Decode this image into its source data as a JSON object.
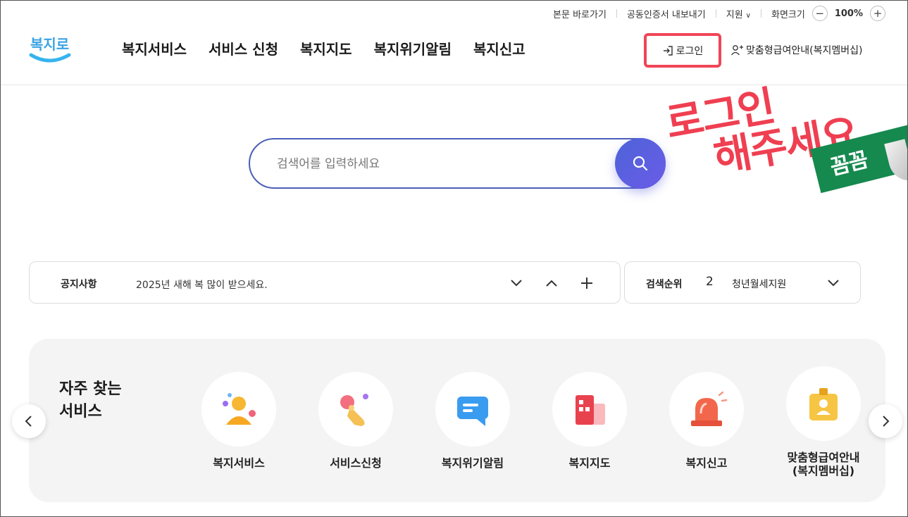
{
  "utility": {
    "skip_to_content": "본문 바로가기",
    "cert_export": "공동인증서 내보내기",
    "support": "지원",
    "screen_size": "화면크기",
    "zoom": "100%"
  },
  "logo": {
    "text": "복지로"
  },
  "nav": [
    "복지서비스",
    "서비스 신청",
    "복지지도",
    "복지위기알림",
    "복지신고"
  ],
  "header": {
    "login": "로그인",
    "membership": "맞춤형급여안내(복지멤버십)"
  },
  "promo": {
    "line1": "로그인",
    "line2": "해주세요",
    "sticker": "꼼꼼"
  },
  "search": {
    "placeholder": "검색어를 입력하세요"
  },
  "notice": {
    "label": "공지사항",
    "text": "2025년 새해 복 많이 받으세요."
  },
  "ranking": {
    "label": "검색순위",
    "number": "2",
    "keyword": "청년월세지원"
  },
  "frequent": {
    "title_line1": "자주 찾는",
    "title_line2": "서비스",
    "items": [
      {
        "label": "복지서비스",
        "icon": "person-icon"
      },
      {
        "label": "서비스신청",
        "icon": "touch-hand-icon"
      },
      {
        "label": "복지위기알림",
        "icon": "message-icon"
      },
      {
        "label": "복지지도",
        "icon": "building-icon"
      },
      {
        "label": "복지신고",
        "icon": "siren-icon"
      },
      {
        "label": "맞춤형급여안내\n(복지멤버십)",
        "icon": "id-badge-icon"
      }
    ]
  },
  "colors": {
    "accent_red": "#ef3f51",
    "search_border": "#4a5fb8",
    "search_button": "#5a5fe0",
    "sticker_green": "#16894e",
    "panel_bg": "#f4f4f4"
  }
}
